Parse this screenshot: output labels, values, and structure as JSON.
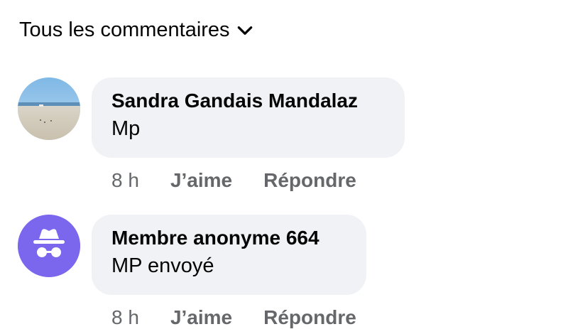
{
  "filter": {
    "label": "Tous les commentaires",
    "icon": "chevron-down-icon"
  },
  "comments": [
    {
      "author": "Sandra Gandais Mandalaz",
      "text": "Mp",
      "time": "8 h",
      "like_label": "J’aime",
      "reply_label": "Répondre",
      "avatar": "beach-photo-avatar"
    },
    {
      "author": "Membre anonyme 664",
      "text": "MP envoyé",
      "time": "8 h",
      "like_label": "J’aime",
      "reply_label": "Répondre",
      "avatar": "anonymous-incognito-icon"
    }
  ],
  "colors": {
    "bubble_bg": "#f0f2f5",
    "text": "#050505",
    "secondary": "#65676b",
    "anon_avatar": "#7b67ee"
  }
}
